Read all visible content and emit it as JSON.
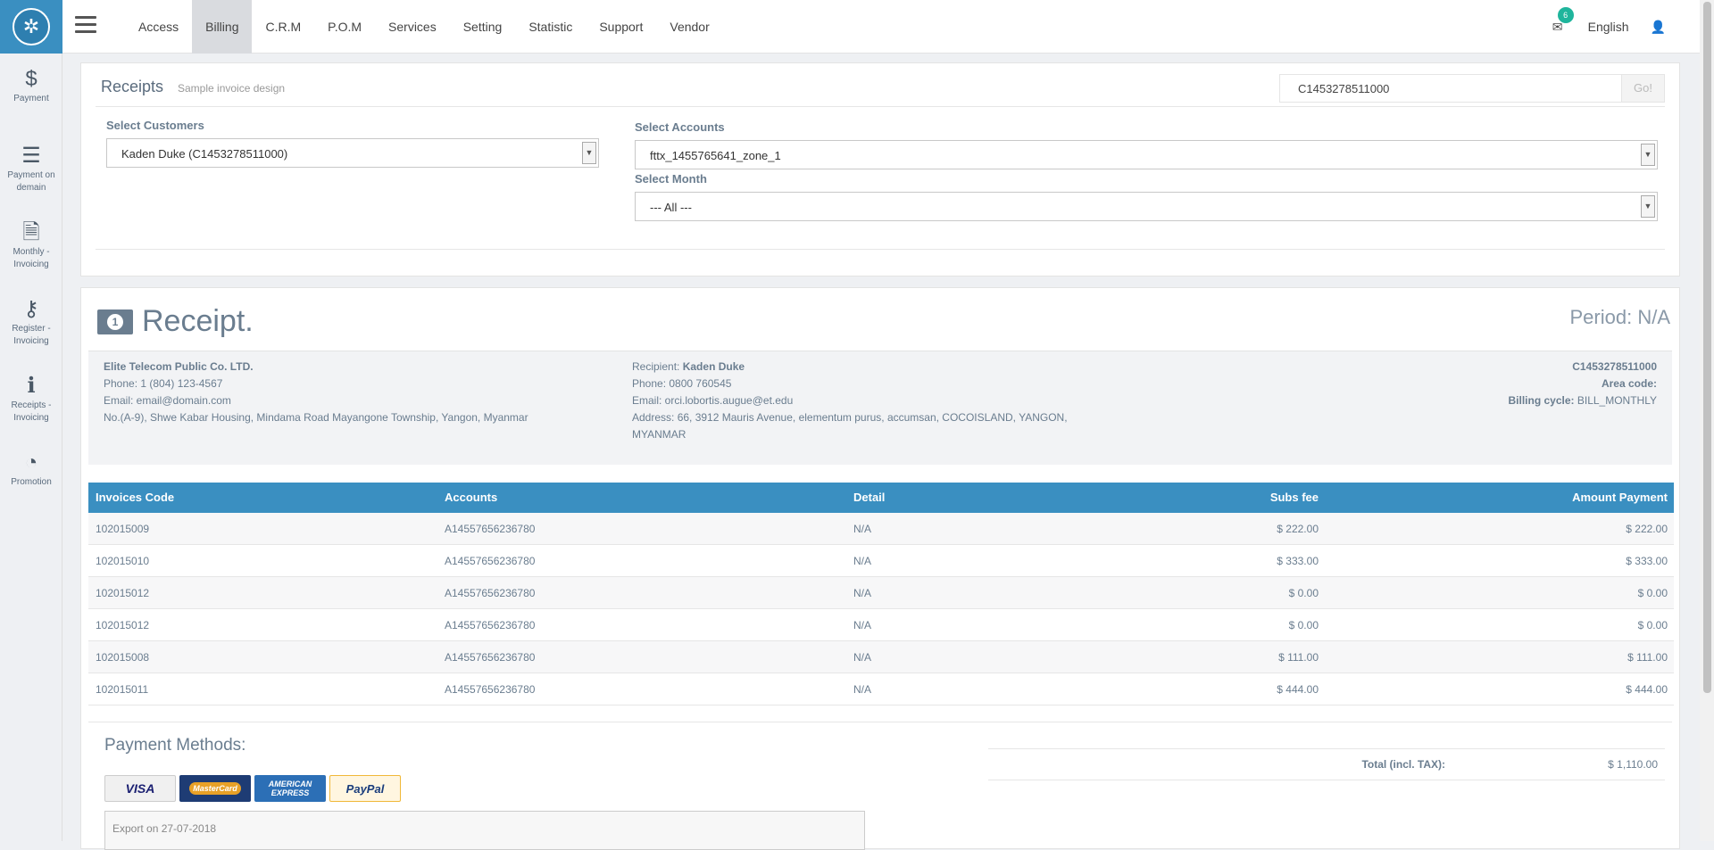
{
  "nav": {
    "items": [
      {
        "label": "Access",
        "active": false
      },
      {
        "label": "Billing",
        "active": true
      },
      {
        "label": "C.R.M",
        "active": false
      },
      {
        "label": "P.O.M",
        "active": false
      },
      {
        "label": "Services",
        "active": false
      },
      {
        "label": "Setting",
        "active": false
      },
      {
        "label": "Statistic",
        "active": false
      },
      {
        "label": "Support",
        "active": false
      },
      {
        "label": "Vendor",
        "active": false
      }
    ],
    "mail_count": "6",
    "language": "English"
  },
  "sidebar": {
    "items": [
      {
        "icon": "dollar-icon",
        "label1": "Payment",
        "label2": ""
      },
      {
        "icon": "list-icon",
        "label1": "Payment on",
        "label2": "demain"
      },
      {
        "icon": "document-icon",
        "label1": "Monthly -",
        "label2": "Invoicing"
      },
      {
        "icon": "key-icon",
        "label1": "Register -",
        "label2": "Invoicing"
      },
      {
        "icon": "info-icon",
        "label1": "Receipts -",
        "label2": "Invoicing"
      },
      {
        "icon": "rss-icon",
        "label1": "Promotion",
        "label2": ""
      }
    ]
  },
  "filters": {
    "title": "Receipts",
    "subtitle": "Sample invoice design",
    "search_value": "C1453278511000",
    "go_label": "Go!",
    "customers_label": "Select Customers",
    "customers_value": "Kaden Duke (C1453278511000)",
    "accounts_label": "Select Accounts",
    "accounts_value": "fttx_1455765641_zone_1",
    "month_label": "Select Month",
    "month_value": "--- All ---"
  },
  "receipt": {
    "title": "Receipt.",
    "period": "Period: N/A",
    "company": {
      "name": "Elite Telecom Public Co. LTD.",
      "phone": "Phone: 1 (804) 123-4567",
      "email": "Email: email@domain.com",
      "address": "No.(A-9), Shwe Kabar Housing, Mindama Road Mayangone Township, Yangon, Myanmar"
    },
    "recipient": {
      "label": "Recipient:",
      "name": "Kaden Duke",
      "phone": "Phone: 0800 760545",
      "email": "Email: orci.lobortis.augue@et.edu",
      "address1": "Address: 66, 3912 Mauris Avenue, elementum purus, accumsan, COCOISLAND, YANGON,",
      "address2": "MYANMAR"
    },
    "meta": {
      "code": "C1453278511000",
      "area_label": "Area code:",
      "cycle_label": "Billing cycle:",
      "cycle_value": "BILL_MONTHLY"
    },
    "columns": [
      "Invoices Code",
      "Accounts",
      "Detail",
      "Subs fee",
      "Amount Payment"
    ],
    "rows": [
      [
        "102015009",
        "A14557656236780",
        "N/A",
        "$ 222.00",
        "$ 222.00"
      ],
      [
        "102015010",
        "A14557656236780",
        "N/A",
        "$ 333.00",
        "$ 333.00"
      ],
      [
        "102015012",
        "A14557656236780",
        "N/A",
        "$ 0.00",
        "$ 0.00"
      ],
      [
        "102015012",
        "A14557656236780",
        "N/A",
        "$ 0.00",
        "$ 0.00"
      ],
      [
        "102015008",
        "A14557656236780",
        "N/A",
        "$ 111.00",
        "$ 111.00"
      ],
      [
        "102015011",
        "A14557656236780",
        "N/A",
        "$ 444.00",
        "$ 444.00"
      ]
    ],
    "payment_title": "Payment Methods:",
    "cards": {
      "visa": "VISA",
      "mastercard": "MasterCard",
      "amex1": "AMERICAN",
      "amex2": "EXPRESS",
      "paypal": "PayPal"
    },
    "export_text": "Export on 27-07-2018",
    "total_label": "Total (incl. TAX):",
    "total_value": "$ 1,110.00"
  }
}
